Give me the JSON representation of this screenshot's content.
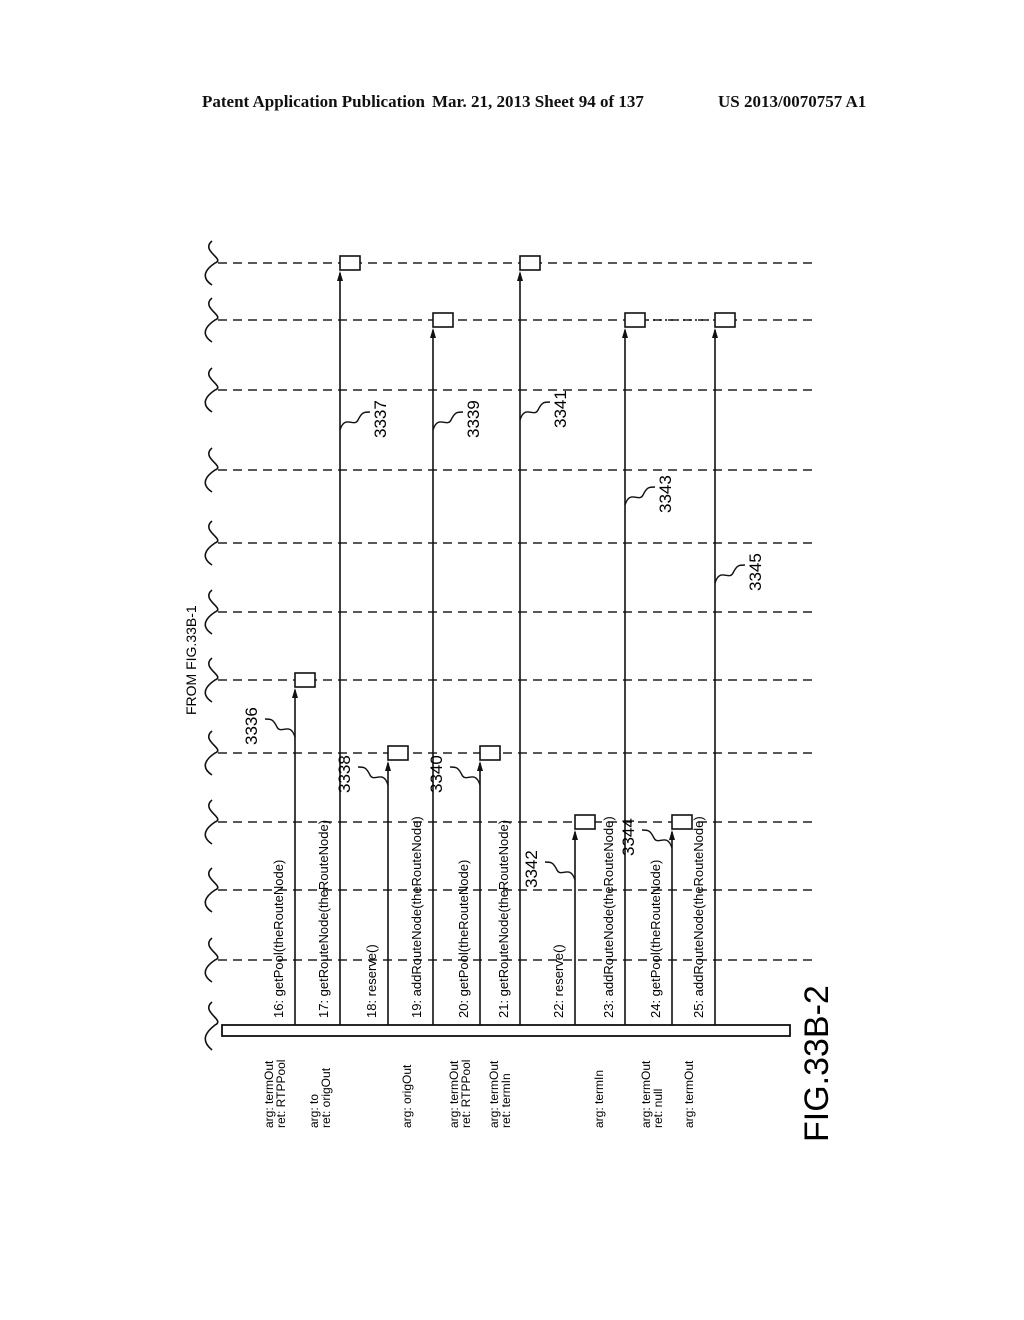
{
  "header": {
    "publication": "Patent Application Publication",
    "date_sheet": "Mar. 21, 2013  Sheet 94 of 137",
    "patent_number": "US 2013/0070757 A1"
  },
  "figure": {
    "label": "FIG.33B-2",
    "continuation_note": "FROM FIG.33B-1"
  },
  "lifelines_count": 11,
  "messages": [
    {
      "seq": "16:",
      "call": "getPool(theRouteNode)",
      "annotation": [
        "arg: termOut",
        "ret: RTPPool"
      ],
      "target_lifeline": 7,
      "ref": "3336"
    },
    {
      "seq": "17:",
      "call": "getRouteNode(theRouteNode)",
      "annotation": [
        "arg: to",
        "ret: origOut"
      ],
      "target_lifeline": 1,
      "ref": "3337"
    },
    {
      "seq": "18:",
      "call": "reserve()",
      "annotation": [],
      "target_lifeline": 8,
      "ref": "3338"
    },
    {
      "seq": "19:",
      "call": "addRouteNode(theRouteNode)",
      "annotation": [
        "arg: origOut"
      ],
      "target_lifeline": 2,
      "ref": "3339"
    },
    {
      "seq": "20:",
      "call": "getPool(theRouteNode)",
      "annotation": [
        "arg: termOut",
        "ret: RTPPool"
      ],
      "target_lifeline": 8,
      "ref": "3340"
    },
    {
      "seq": "21:",
      "call": "getRouteNode(theRouteNode)",
      "annotation": [
        "arg: termOut",
        "ret: termIn"
      ],
      "target_lifeline": 1,
      "ref": "3341"
    },
    {
      "seq": "22:",
      "call": "reserve()",
      "annotation": [],
      "target_lifeline": 9,
      "ref": "3342"
    },
    {
      "seq": "23:",
      "call": "addRouteNode(theRouteNode)",
      "annotation": [
        "arg: termIn"
      ],
      "target_lifeline": 2,
      "ref": "3343"
    },
    {
      "seq": "24:",
      "call": "getPool(theRouteNode)",
      "annotation": [
        "arg: termOut",
        "ret: null"
      ],
      "target_lifeline": 9,
      "ref": "3344"
    },
    {
      "seq": "25:",
      "call": "addRouteNode(theRouteNode)",
      "annotation": [
        "arg: termOut"
      ],
      "target_lifeline": 2,
      "ref": "3345"
    }
  ]
}
